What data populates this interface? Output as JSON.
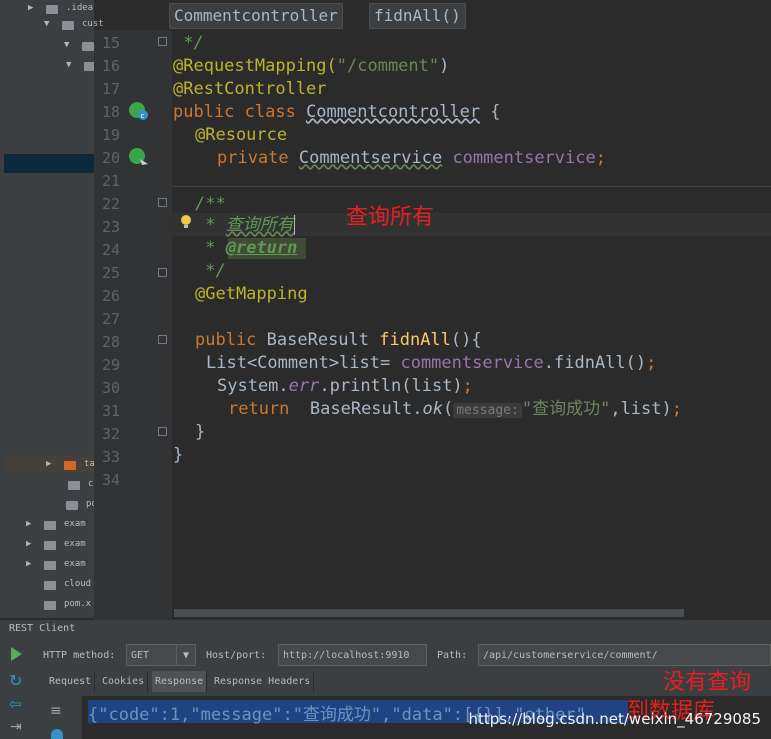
{
  "tree": {
    "items": [
      {
        "arrow": "▶",
        "label": ".idea"
      },
      {
        "arrow": "▼",
        "label": "cust"
      },
      {
        "arrow": "▼",
        "label": "s"
      },
      {
        "arrow": "▼",
        "label": ""
      },
      {
        "arrow": "▶",
        "label": "ta"
      },
      {
        "arrow": "",
        "label": "c"
      },
      {
        "arrow": "",
        "label": "po"
      },
      {
        "arrow": "▶",
        "label": "exam"
      },
      {
        "arrow": "▶",
        "label": "exam"
      },
      {
        "arrow": "▶",
        "label": "exam"
      },
      {
        "arrow": "",
        "label": "cloud"
      },
      {
        "arrow": "",
        "label": "pom.x"
      }
    ]
  },
  "breadcrumbs": [
    "Commentcontroller",
    "fidnAll()"
  ],
  "line_numbers": [
    "15",
    "16",
    "17",
    "18",
    "19",
    "20",
    "21",
    "22",
    "23",
    "24",
    "25",
    "26",
    "27",
    "28",
    "29",
    "30",
    "31",
    "32",
    "33",
    "34"
  ],
  "code": {
    "l15": " */",
    "l16_an": "@RequestMapping(",
    "l16_str": "\"/comment\"",
    "l16_end": ")",
    "l17": "@RestController",
    "l18_kw": "public class ",
    "l18_cls": "Commentcontroller",
    "l18_end": " {",
    "l19": "@Resource",
    "l20_kw": "private ",
    "l20_type": "Commentservice",
    "l20_fld": "commentservice",
    "l20_end": ";",
    "l22": "/**",
    "l23_star": " * ",
    "l23_text": "查询所有",
    "l24_star": " * ",
    "l24_tag": "@return",
    "l25": " */",
    "l26": "@GetMapping",
    "l28_kw": "public ",
    "l28_type": "BaseResult ",
    "l28_fn": "fidnAll",
    "l28_end": "(){",
    "l29_a": "List<Comment>list= ",
    "l29_fld": "commentservice",
    "l29_b": ".fidnAll()",
    "l29_end": ";",
    "l30_a": "System.",
    "l30_err": "err",
    "l30_b": ".println(list)",
    "l30_end": ";",
    "l31_kw": "return  ",
    "l31_a": "BaseResult.",
    "l31_ok": "ok",
    "l31_paren": "(",
    "l31_hint": "message:",
    "l31_str": "\"查询成功\"",
    "l31_b": ",list)",
    "l31_end": ";",
    "l32": "}",
    "l33": "}"
  },
  "annotations": {
    "query_all": "查询所有",
    "no_query_line1": "没有查询",
    "no_query_line2": "到数据库"
  },
  "rest_client": {
    "title": "REST Client",
    "http_method_label": "HTTP method:",
    "http_method_value": "GET",
    "host_label": "Host/port:",
    "host_value": "http://localhost:9910",
    "path_label": "Path:",
    "path_value": "/api/customerservice/comment/",
    "tabs": [
      "Request",
      "Cookies",
      "Response",
      "Response Headers"
    ],
    "active_tab": "Response",
    "response_text": "{\"code\":1,\"message\":\"查询成功\",\"data\":[{}],\"other\""
  },
  "watermark": "https://blog.csdn.net/weixin_46729085"
}
